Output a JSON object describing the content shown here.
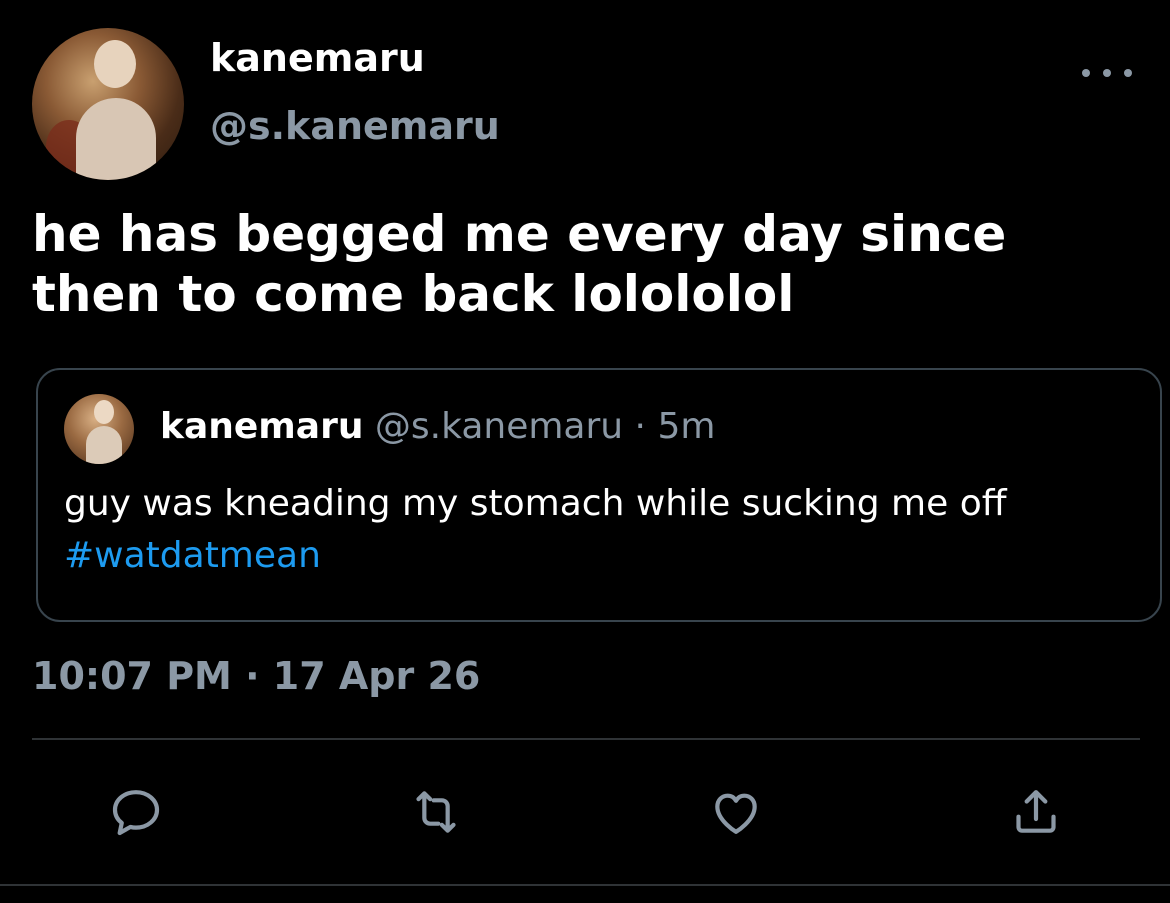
{
  "author": {
    "display_name": "kanemaru",
    "handle": "@s.kanemaru"
  },
  "tweet": {
    "text": "he has begged me every day since then to come back lolololol",
    "timestamp": "10:07 PM · 17 Apr 26"
  },
  "quoted": {
    "display_name": "kanemaru",
    "handle": "@s.kanemaru",
    "time_meta": " · 5m",
    "text": "guy was kneading my stomach while sucking me off ",
    "hashtag": "#watdatmean"
  },
  "actions": {
    "reply_icon": "reply-icon",
    "retweet_icon": "retweet-icon",
    "like_icon": "heart-icon",
    "share_icon": "share-icon"
  },
  "colors": {
    "background": "#000000",
    "primary_text": "#ffffff",
    "secondary_text": "#8b98a5",
    "link": "#1d9bf0",
    "border": "#38444d"
  }
}
